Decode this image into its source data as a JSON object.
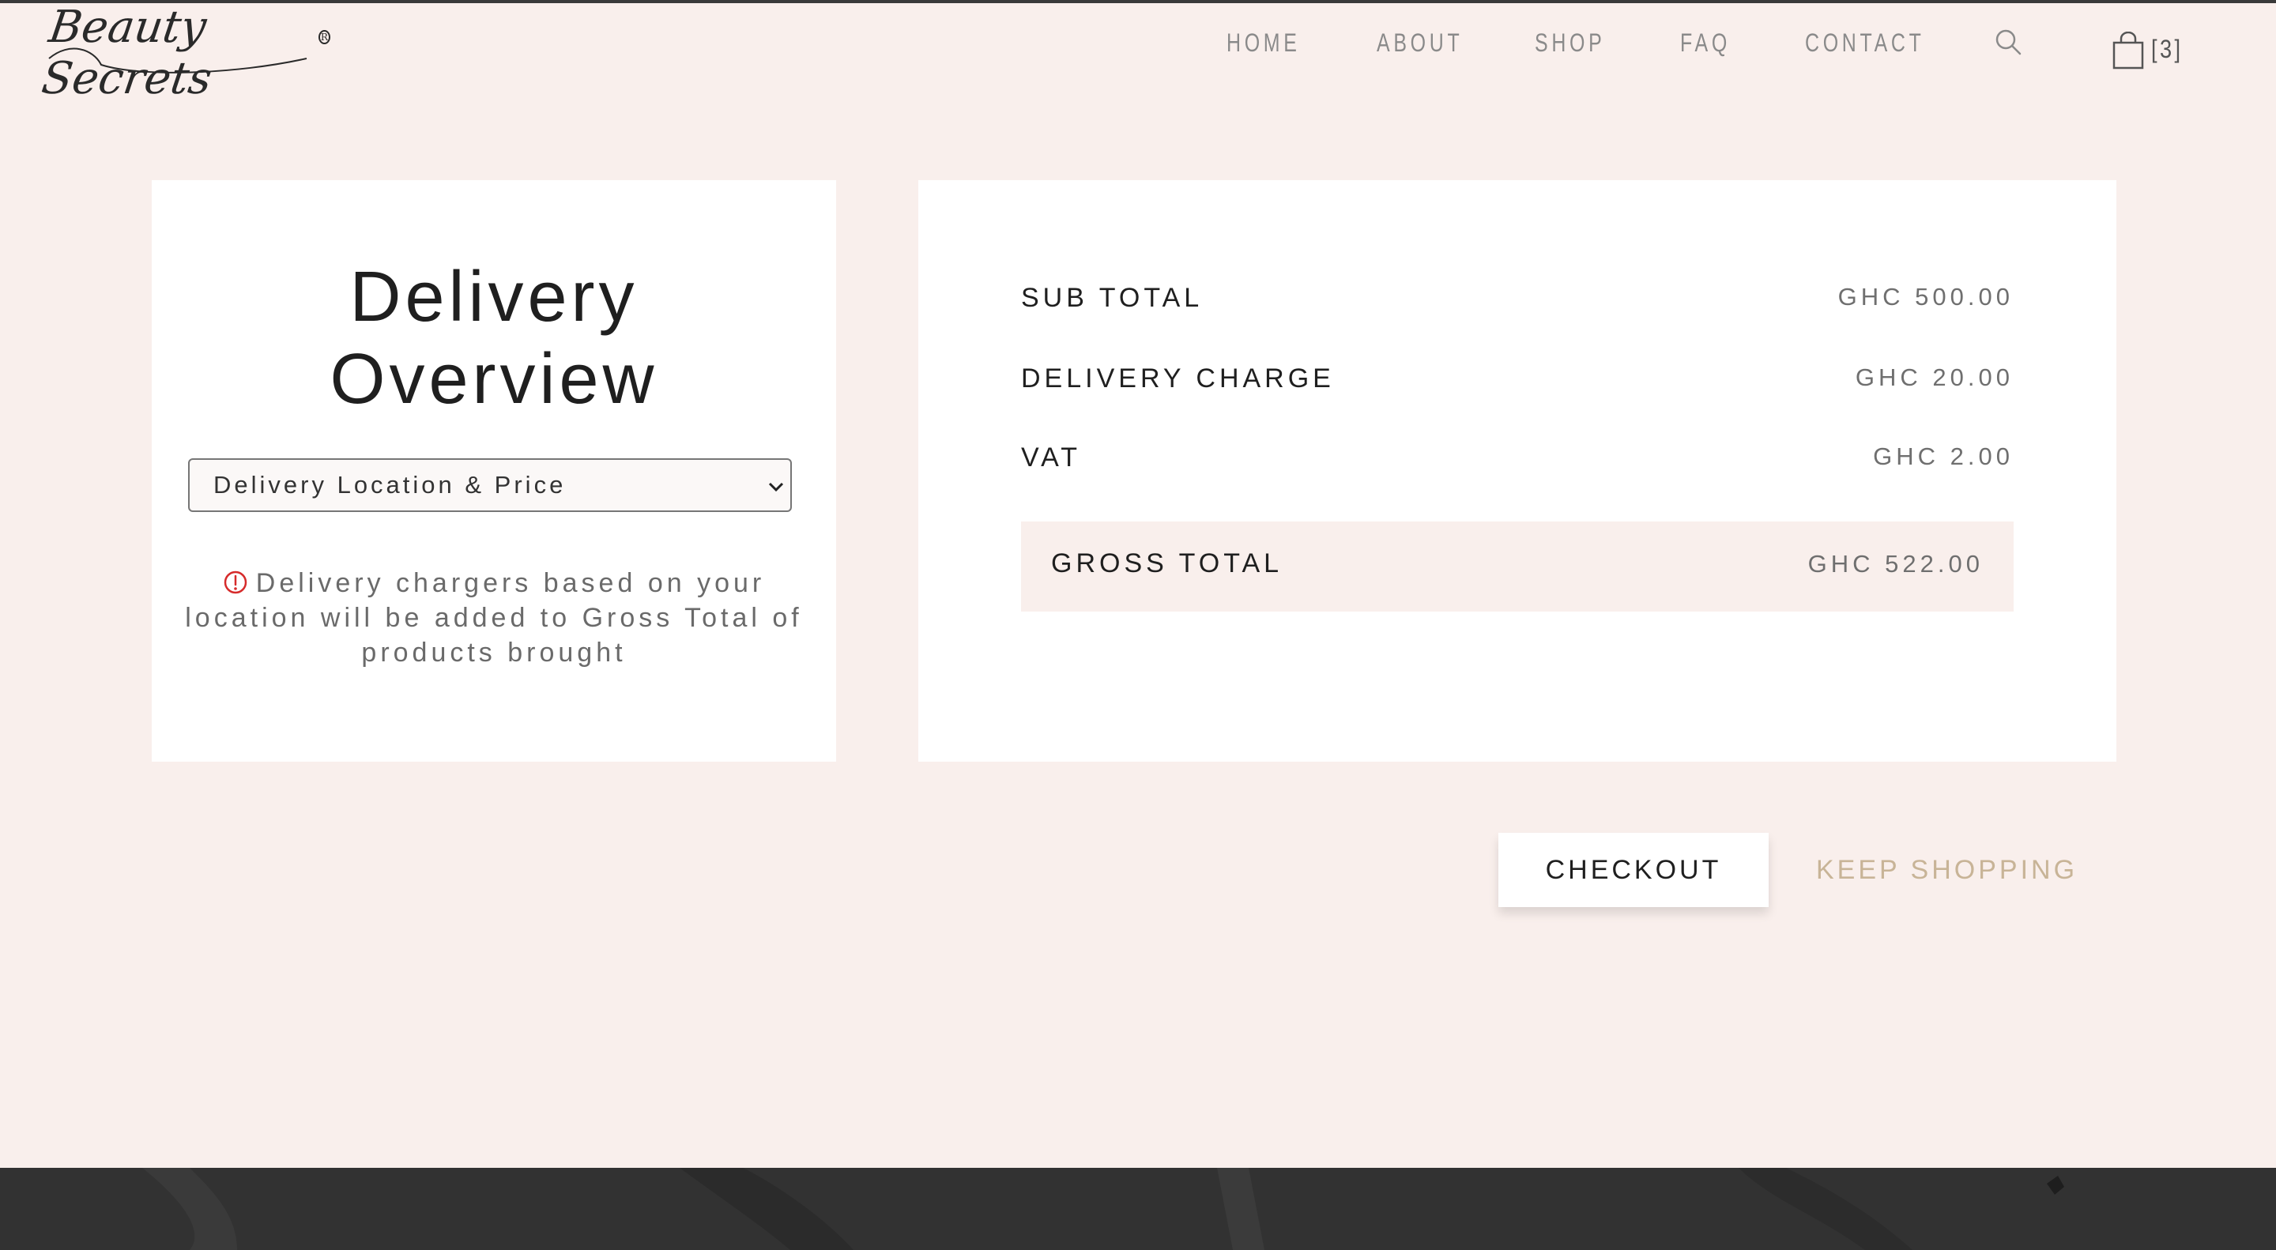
{
  "brand": {
    "logo_text": "Beauty Secrets",
    "registered_mark": "R"
  },
  "nav": {
    "items": [
      "HOME",
      "ABOUT",
      "SHOP",
      "FAQ",
      "CONTACT"
    ],
    "cart_count": "[3]"
  },
  "delivery": {
    "title_line1": "Delivery",
    "title_line2": "Overview",
    "select_value": "Delivery Location & Price",
    "note": "Delivery chargers based on your location will be added to Gross Total of products brought"
  },
  "summary": {
    "rows": [
      {
        "label": "SUB TOTAL",
        "value": "GHC 500.00"
      },
      {
        "label": "DELIVERY CHARGE",
        "value": "GHC 20.00"
      },
      {
        "label": "VAT",
        "value": "GHC 2.00"
      }
    ],
    "gross": {
      "label": "GROSS TOTAL",
      "value": "GHC 522.00"
    }
  },
  "actions": {
    "checkout": "CHECKOUT",
    "keep_shopping": "KEEP SHOPPING"
  },
  "colors": {
    "background": "#f9efec",
    "card": "#ffffff",
    "accent_gold": "#c8b497",
    "alert_red": "#d62b2b",
    "footer": "#323232"
  },
  "icons": {
    "search": "search-icon",
    "cart": "shopping-bag-icon",
    "alert": "alert-circle-icon",
    "chevron": "chevron-down-icon"
  }
}
